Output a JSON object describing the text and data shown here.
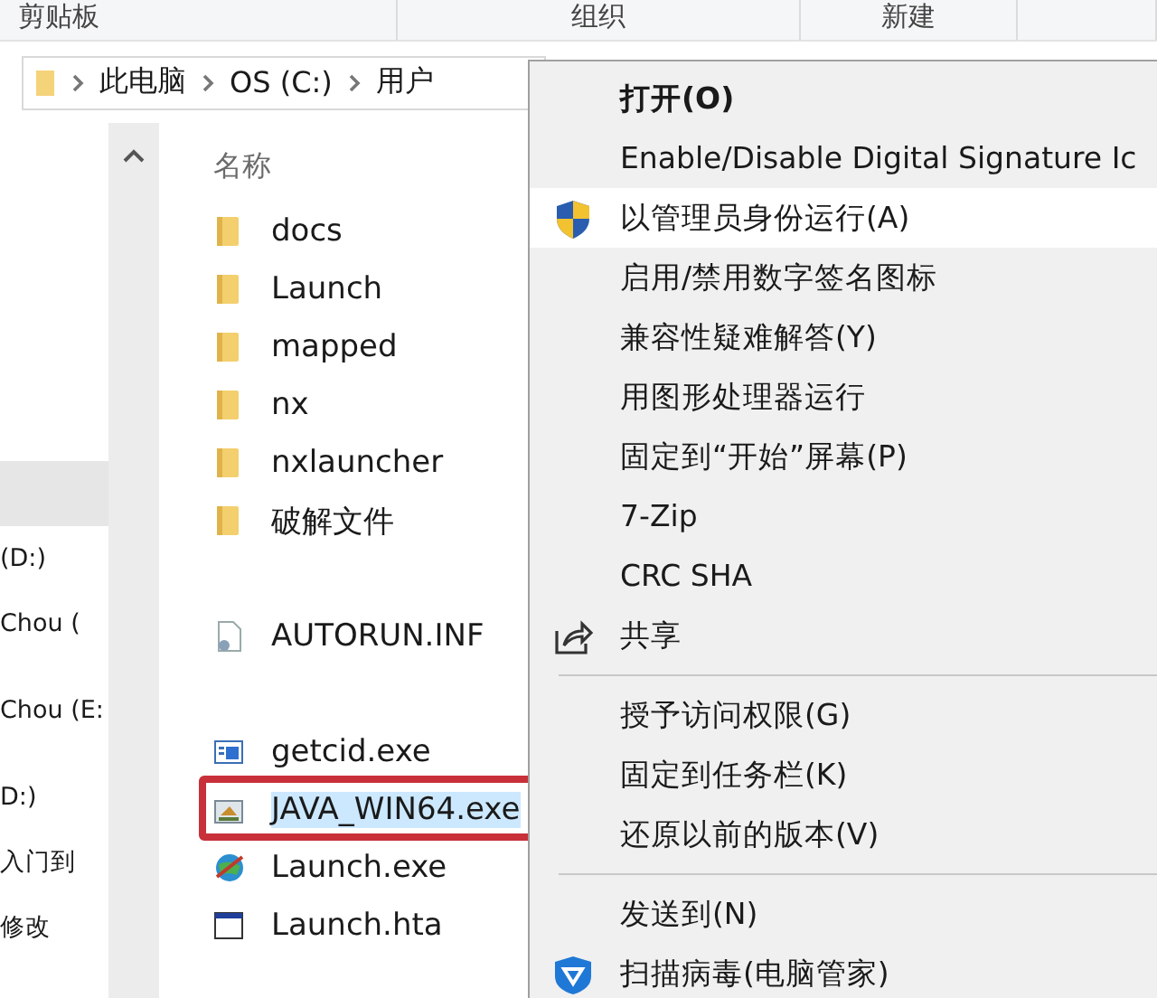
{
  "ribbon": [
    {
      "label": "剪贴板"
    },
    {
      "label": "组织"
    },
    {
      "label": "新建"
    }
  ],
  "address": {
    "crumbs": [
      "此电脑",
      "OS (C:)",
      "用户"
    ]
  },
  "sidebar": {
    "groups": [
      [
        {
          "label": "(D:)"
        },
        {
          "label": "Chou ("
        }
      ],
      [
        {
          "label": "Chou (E:"
        }
      ],
      [
        {
          "label": "D:)"
        },
        {
          "label": "入门到"
        },
        {
          "label": "修改"
        }
      ]
    ]
  },
  "files": {
    "header": "名称",
    "groups": [
      [
        {
          "name": "docs",
          "kind": "folder",
          "selected": false,
          "marked": false
        },
        {
          "name": "Launch",
          "kind": "folder",
          "selected": false,
          "marked": false
        },
        {
          "name": "mapped",
          "kind": "folder",
          "selected": false,
          "marked": false
        },
        {
          "name": "nx",
          "kind": "folder",
          "selected": false,
          "marked": false
        },
        {
          "name": "nxlauncher",
          "kind": "folder",
          "selected": false,
          "marked": false
        },
        {
          "name": "破解文件",
          "kind": "folder",
          "selected": false,
          "marked": false
        }
      ],
      [
        {
          "name": "AUTORUN.INF",
          "kind": "settings",
          "selected": false,
          "marked": false
        }
      ],
      [
        {
          "name": "getcid.exe",
          "kind": "app",
          "selected": false,
          "marked": false
        },
        {
          "name": "JAVA_WIN64.exe",
          "kind": "installer",
          "selected": true,
          "marked": true
        },
        {
          "name": "Launch.exe",
          "kind": "globe",
          "selected": false,
          "marked": false
        },
        {
          "name": "Launch.hta",
          "kind": "window",
          "selected": false,
          "marked": false
        }
      ]
    ]
  },
  "context_menu": {
    "items": [
      {
        "kind": "item",
        "label": "打开(O)",
        "default": true,
        "selected": false
      },
      {
        "kind": "item",
        "label": "Enable/Disable Digital Signature Ic",
        "default": false,
        "selected": false
      },
      {
        "kind": "admin-item",
        "label": "以管理员身份运行(A)",
        "default": false,
        "selected": true
      },
      {
        "kind": "item",
        "label": "启用/禁用数字签名图标",
        "default": false,
        "selected": false
      },
      {
        "kind": "item",
        "label": "兼容性疑难解答(Y)",
        "default": false,
        "selected": false
      },
      {
        "kind": "item",
        "label": "用图形处理器运行",
        "default": false,
        "selected": false
      },
      {
        "kind": "item",
        "label": "固定到“开始”屏幕(P)",
        "default": false,
        "selected": false
      },
      {
        "kind": "item",
        "label": "7-Zip",
        "default": false,
        "selected": false
      },
      {
        "kind": "item",
        "label": "CRC SHA",
        "default": false,
        "selected": false
      },
      {
        "kind": "share-item",
        "label": "共享",
        "default": false,
        "selected": false
      },
      {
        "kind": "separator"
      },
      {
        "kind": "item",
        "label": "授予访问权限(G)",
        "default": false,
        "selected": false
      },
      {
        "kind": "item",
        "label": "固定到任务栏(K)",
        "default": false,
        "selected": false
      },
      {
        "kind": "item",
        "label": "还原以前的版本(V)",
        "default": false,
        "selected": false
      },
      {
        "kind": "separator"
      },
      {
        "kind": "item",
        "label": "发送到(N)",
        "default": false,
        "selected": false
      },
      {
        "kind": "scan-item",
        "label": "扫描病毒(电脑管家)",
        "default": false,
        "selected": false
      }
    ]
  }
}
